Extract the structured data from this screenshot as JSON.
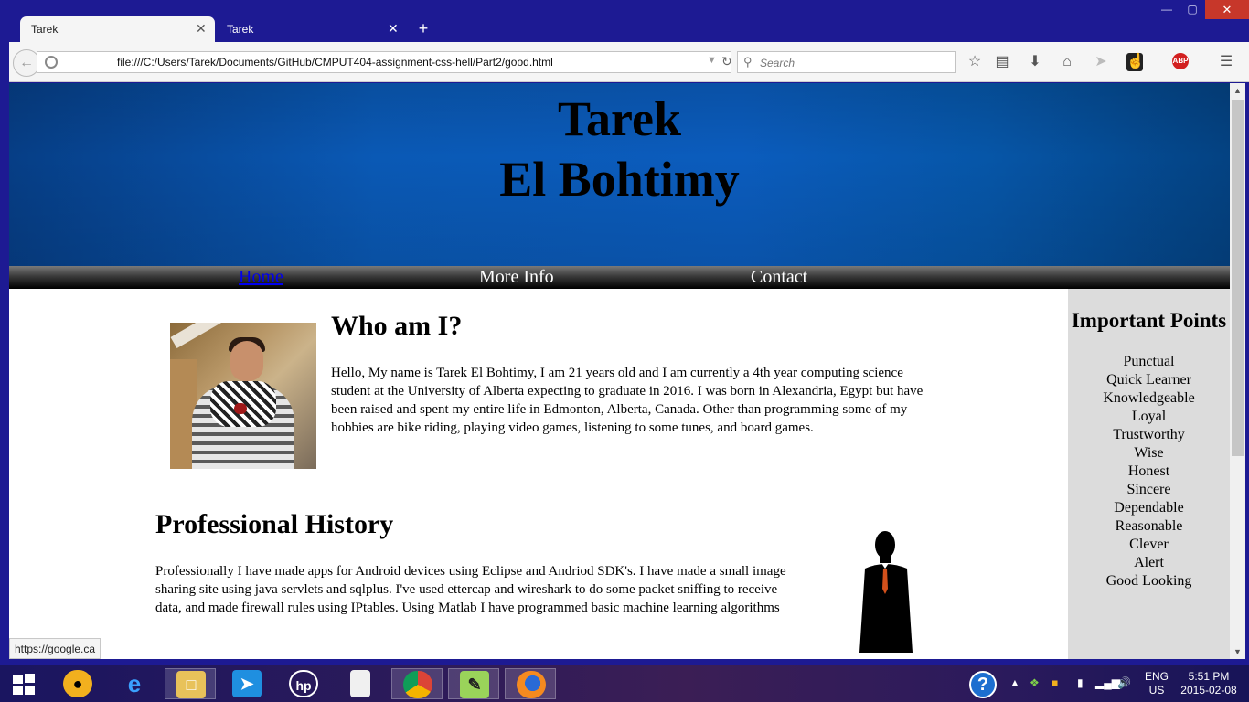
{
  "browser": {
    "tabs": [
      {
        "label": "Tarek",
        "close_glyph": "✕"
      },
      {
        "label": "Tarek",
        "close_glyph": "✕"
      }
    ],
    "new_tab_glyph": "+",
    "window_controls": {
      "minimize": "—",
      "maximize": "▢",
      "close": "✕"
    },
    "url": "file:///C:/Users/Tarek/Documents/GitHub/CMPUT404-assignment-css-hell/Part2/good.html",
    "search_placeholder": "Search",
    "toolbar_icons": [
      "bookmark-star-icon",
      "reading-list-icon",
      "download-icon",
      "home-icon",
      "share-icon",
      "extension-icon",
      "adblock-icon",
      "menu-icon"
    ],
    "status_tooltip": "https://google.ca"
  },
  "page": {
    "header_title_line1": "Tarek",
    "header_title_line2": "El Bohtimy",
    "nav": {
      "home": "Home",
      "more_info": "More Info",
      "contact": "Contact"
    },
    "who": {
      "heading": "Who am I?",
      "text": "Hello, My name is Tarek El Bohtimy, I am 21 years old and I am currently a 4th year computing science student at the University of Alberta expecting to graduate in 2016. I was born in Alexandria, Egypt but have been raised and spent my entire life in Edmonton, Alberta, Canada. Other than programming some of my hobbies are bike riding, playing video games, listening to some tunes, and board games."
    },
    "history": {
      "heading": "Professional History",
      "text": "Professionally I have made apps for Android devices using Eclipse and Andriod SDK's. I have made a small image sharing site using java servlets and sqlplus. I've used ettercap and wireshark to do some packet sniffing to receive data, and made firewall rules using IPtables. Using Matlab I have programmed basic machine learning algorithms"
    },
    "sidebar": {
      "title": "Important Points",
      "items": [
        "Punctual",
        "Quick Learner",
        "Knowledgeable",
        "Loyal",
        "Trustworthy",
        "Wise",
        "Honest",
        "Sincere",
        "Dependable",
        "Reasonable",
        "Clever",
        "Alert",
        "Good Looking"
      ]
    },
    "colors": {
      "header_blue": "#0b5cbd",
      "nav_black": "#000000",
      "sidebar_gray": "#dcdcdc",
      "link_blue": "#0000ee"
    }
  },
  "taskbar": {
    "apps": [
      "start-icon",
      "media-player-icon",
      "internet-explorer-icon",
      "file-explorer-icon",
      "rocket-app-icon",
      "hp-icon",
      "file-icon",
      "chrome-icon",
      "notepad-plus-plus-icon",
      "firefox-icon"
    ],
    "help_glyph": "?",
    "tray_glyph": "▲",
    "lang_top": "ENG",
    "lang_bottom": "US",
    "time": "5:51 PM",
    "date": "2015-02-08"
  }
}
